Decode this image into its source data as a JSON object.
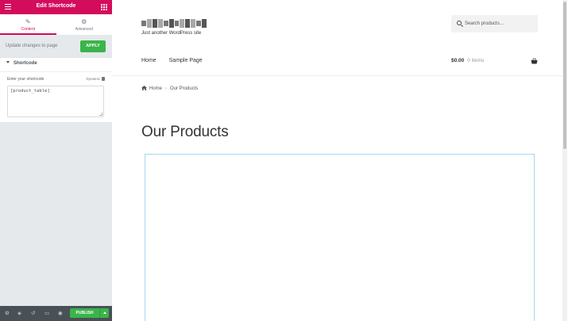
{
  "editor": {
    "title": "Edit Shortcode",
    "tabs": [
      {
        "label": "Content",
        "icon": "pencil-icon",
        "active": true
      },
      {
        "label": "Advanced",
        "icon": "gear-icon",
        "active": false
      }
    ],
    "update_label": "Update changes to page",
    "apply_label": "APPLY",
    "section_title": "Shortcode",
    "field_label": "Enter your shortcode",
    "dynamic_label": "Dynamic",
    "shortcode_value": "[product_table]",
    "footer": {
      "publish_label": "PUBLISH"
    },
    "colors": {
      "accent": "#d30c5c",
      "publish": "#39b54a",
      "footer": "#495157"
    }
  },
  "site": {
    "tagline": "Just another WordPress site",
    "search_placeholder": "Search products…",
    "nav": [
      "Home",
      "Sample Page"
    ],
    "cart": {
      "amount": "$0.00",
      "items": "0 items"
    },
    "breadcrumb": {
      "home": "Home",
      "separator": "›",
      "current": "Our Products"
    },
    "page_title": "Our Products"
  }
}
